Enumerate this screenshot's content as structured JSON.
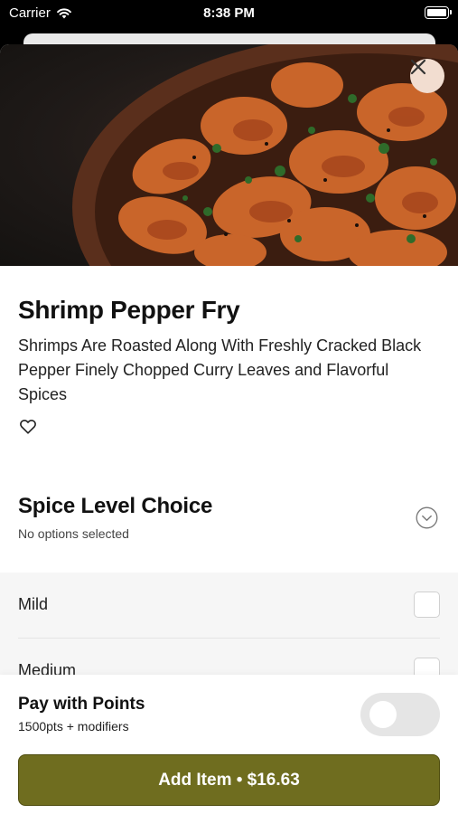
{
  "status_bar": {
    "carrier": "Carrier",
    "time": "8:38 PM"
  },
  "item": {
    "name": "Shrimp Pepper Fry",
    "description": "Shrimps Are Roasted Along With Freshly Cracked Black Pepper Finely Chopped Curry Leaves and Flavorful Spices"
  },
  "spice_section": {
    "title": "Spice Level Choice",
    "subtitle": "No options selected",
    "options": [
      {
        "label": "Mild",
        "checked": false
      },
      {
        "label": "Medium",
        "checked": false
      }
    ]
  },
  "points": {
    "title": "Pay with Points",
    "subtitle": "1500pts + modifiers",
    "enabled": false
  },
  "add_button": {
    "label": "Add Item • $16.63"
  },
  "colors": {
    "accent": "#6f6d1f",
    "close_button_bg": "#f2ddd0"
  },
  "icons": {
    "wifi": "wifi-icon",
    "battery": "battery-icon",
    "close": "close-icon",
    "favorite": "heart-icon",
    "expand": "chevron-down-circle-icon"
  }
}
